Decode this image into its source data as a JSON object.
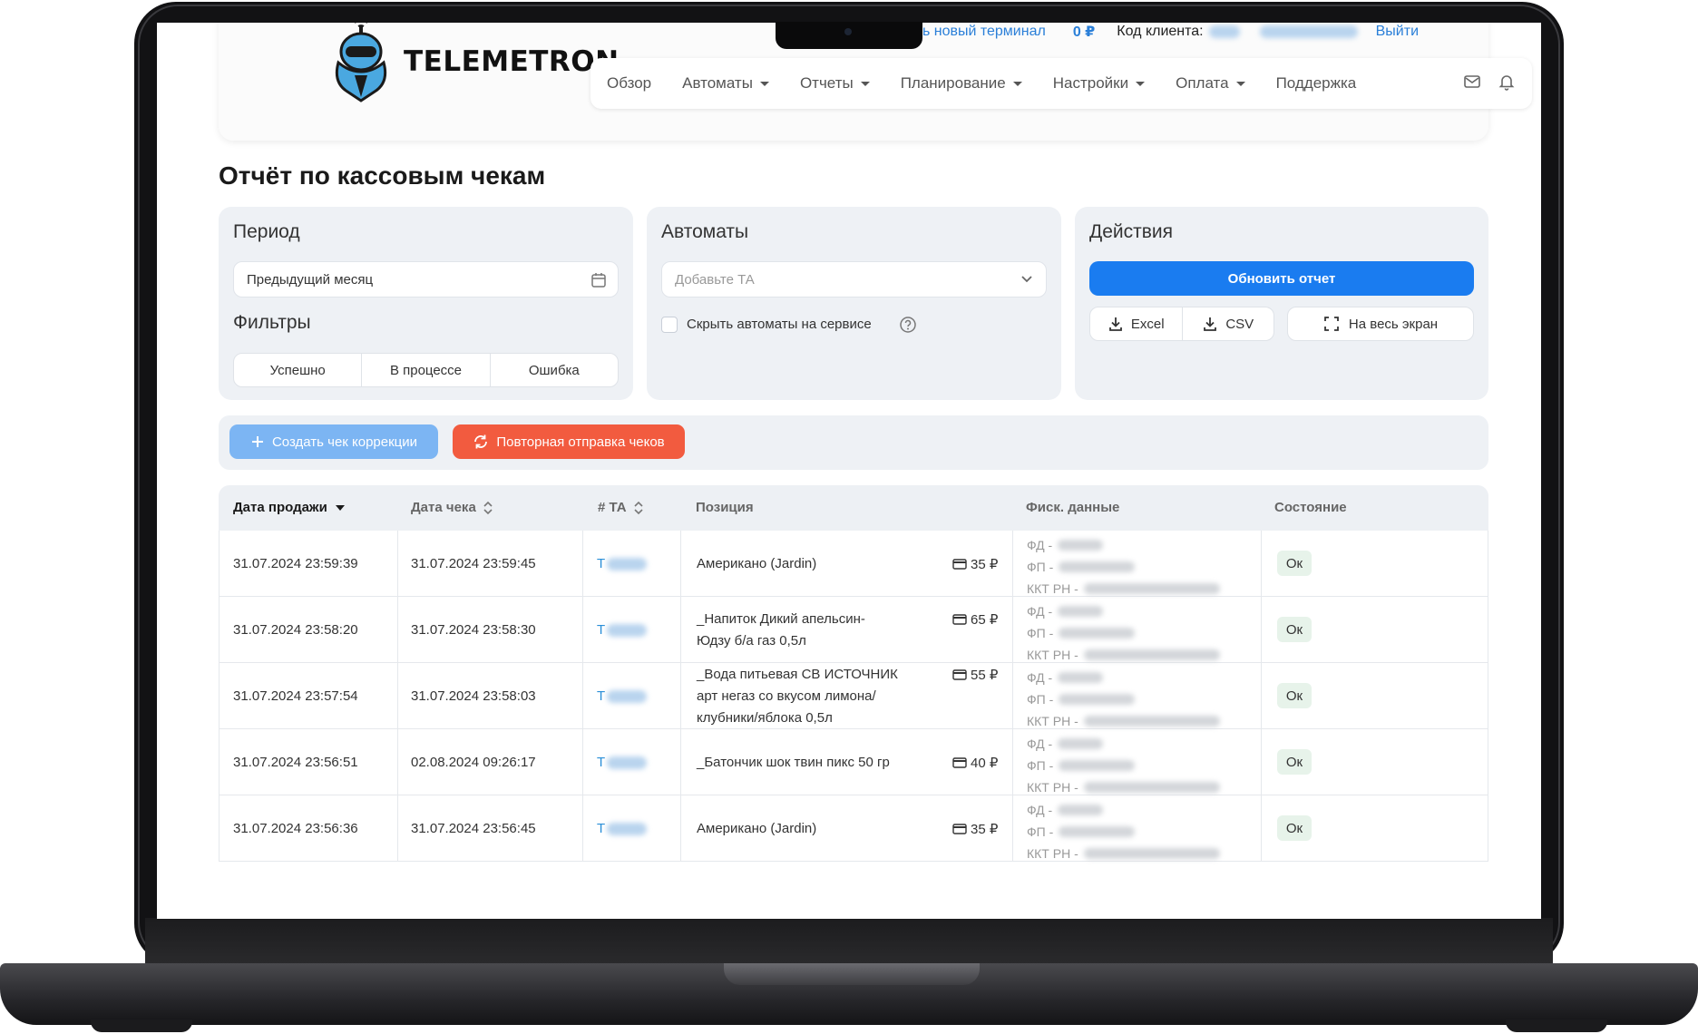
{
  "app": {
    "logo_text": "TELEMETRON",
    "buy_terminal": "Купить новый терминал",
    "balance": "0 ₽",
    "client_code_label": "Код клиента:",
    "logout": "Выйти"
  },
  "nav": {
    "items": [
      {
        "label": "Обзор",
        "dropdown": false
      },
      {
        "label": "Автоматы",
        "dropdown": true
      },
      {
        "label": "Отчеты",
        "dropdown": true
      },
      {
        "label": "Планирование",
        "dropdown": true
      },
      {
        "label": "Настройки",
        "dropdown": true
      },
      {
        "label": "Оплата",
        "dropdown": true
      },
      {
        "label": "Поддержка",
        "dropdown": false
      }
    ],
    "icons": [
      "mail-icon",
      "bell-icon"
    ]
  },
  "page": {
    "title": "Отчёт по кассовым чекам"
  },
  "period": {
    "title": "Период",
    "value": "Предыдущий месяц"
  },
  "filters": {
    "title": "Фильтры",
    "options": [
      "Успешно",
      "В процессе",
      "Ошибка"
    ]
  },
  "machines": {
    "title": "Автоматы",
    "placeholder": "Добавьте ТА",
    "hide_service_label": "Скрыть автоматы на сервисе"
  },
  "actions": {
    "title": "Действия",
    "refresh": "Обновить отчет",
    "excel": "Excel",
    "csv": "CSV",
    "fullscreen": "На весь экран"
  },
  "toolbar": {
    "create_correction": "Создать чек коррекции",
    "resend": "Повторная отправка чеков"
  },
  "table": {
    "columns": [
      "Дата продажи",
      "Дата чека",
      "# ТА",
      "Позиция",
      "Фиск. данные",
      "Состояние"
    ],
    "fisc_labels": [
      "ФД -",
      "ФП -",
      "ККТ РН -"
    ],
    "rows": [
      {
        "sale_date": "31.07.2024 23:59:39",
        "check_date": "31.07.2024 23:59:45",
        "ta": "Т",
        "position_lines": [
          "Американо (Jardin)"
        ],
        "price": "35 ₽",
        "status": "Ок"
      },
      {
        "sale_date": "31.07.2024 23:58:20",
        "check_date": "31.07.2024 23:58:30",
        "ta": "Т",
        "position_lines": [
          "_Напиток Дикий апельсин-",
          "Юдзу б/а газ 0,5л"
        ],
        "price": "65 ₽",
        "status": "Ок"
      },
      {
        "sale_date": "31.07.2024 23:57:54",
        "check_date": "31.07.2024 23:58:03",
        "ta": "Т",
        "position_lines": [
          "_Вода питьевая СВ ИСТОЧНИК",
          "арт негаз со вкусом лимона/",
          "клубники/яблока 0,5л"
        ],
        "price": "55 ₽",
        "status": "Ок"
      },
      {
        "sale_date": "31.07.2024 23:56:51",
        "check_date": "02.08.2024 09:26:17",
        "ta": "Т",
        "position_lines": [
          "_Батончик шок твин пикс 50 гр"
        ],
        "price": "40 ₽",
        "status": "Ок"
      },
      {
        "sale_date": "31.07.2024 23:56:36",
        "check_date": "31.07.2024 23:56:45",
        "ta": "Т",
        "position_lines": [
          "Американо (Jardin)"
        ],
        "price": "35 ₽",
        "status": "Ок"
      }
    ]
  },
  "colors": {
    "primary": "#1a7cf0",
    "light_primary": "#7cb5f3",
    "danger": "#f25b3f",
    "link": "#2a7fd8",
    "panel_bg": "#eef1f5",
    "ok_bg": "#e7f3ea"
  }
}
